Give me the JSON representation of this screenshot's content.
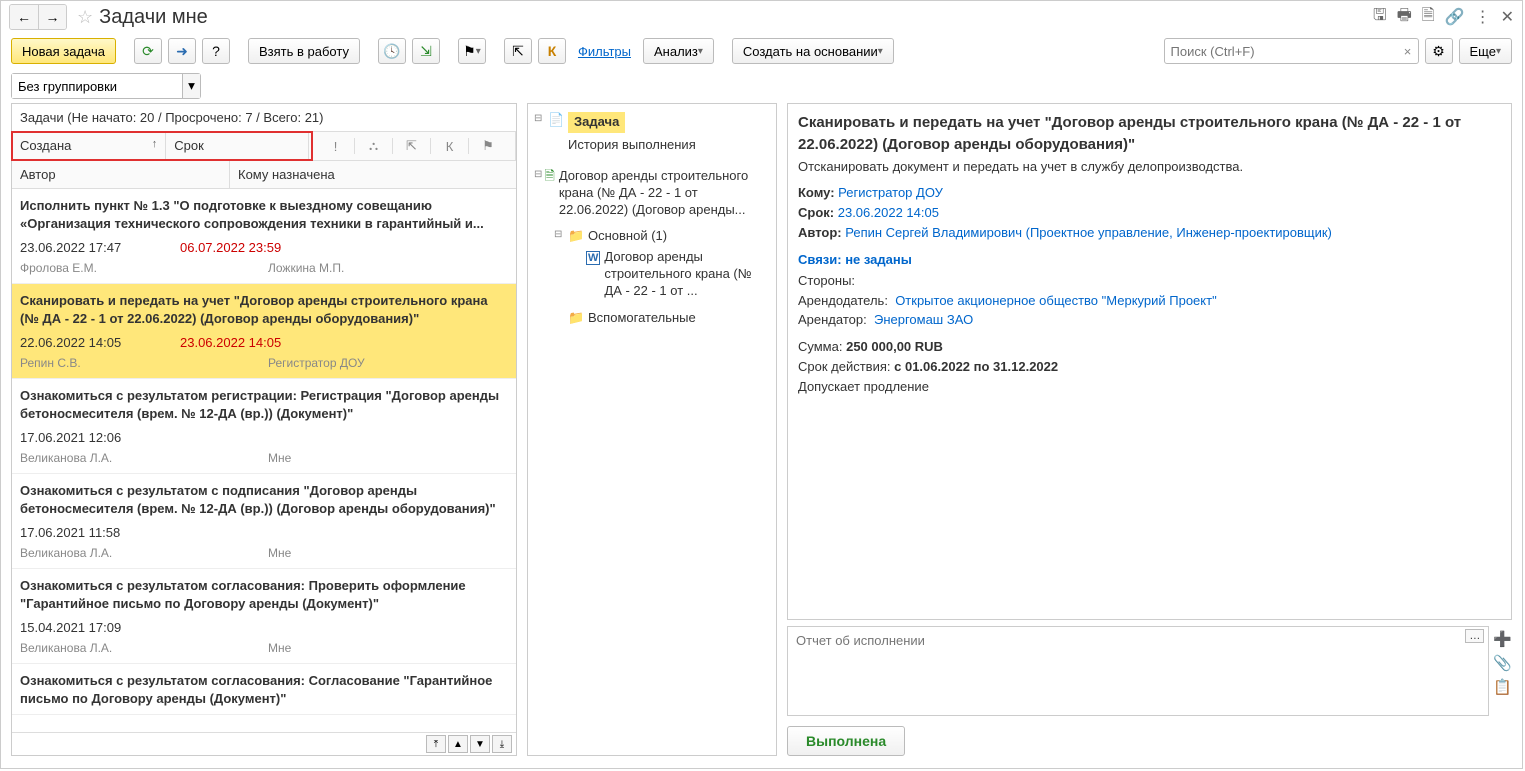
{
  "header": {
    "title": "Задачи мне"
  },
  "toolbar": {
    "new_task": "Новая задача",
    "take_to_work": "Взять в работу",
    "filters": "Фильтры",
    "analysis": "Анализ",
    "create_based_on": "Создать на основании",
    "search_placeholder": "Поиск (Ctrl+F)",
    "more": "Еще"
  },
  "grouping": {
    "value": "Без группировки"
  },
  "status_line": "Задачи (Не начато: 20 / Просрочено: 7 / Всего: 21)",
  "columns": {
    "created": "Создана",
    "due": "Срок",
    "author": "Автор",
    "assigned": "Кому назначена",
    "k_label": "К"
  },
  "tasks": [
    {
      "title": "Исполнить пункт № 1.3 \"О подготовке к выездному совещанию «Организация технического сопровождения техники в гарантийный и...",
      "created": "23.06.2022 17:47",
      "due": "06.07.2022 23:59",
      "overdue": true,
      "author": "Фролова Е.М.",
      "assigned": "Ложкина М.П."
    },
    {
      "title": "Сканировать и передать на учет \"Договор аренды строительного крана (№ ДА - 22 - 1 от 22.06.2022) (Договор аренды оборудования)\"",
      "created": "22.06.2022 14:05",
      "due": "23.06.2022 14:05",
      "overdue": true,
      "author": "Репин С.В.",
      "assigned": "Регистратор ДОУ",
      "selected": true
    },
    {
      "title": "Ознакомиться с результатом регистрации: Регистрация \"Договор аренды бетоносмесителя (врем. № 12-ДА (вр.)) (Документ)\"",
      "created": "17.06.2021 12:06",
      "due": "",
      "author": "Великанова Л.А.",
      "assigned": "Мне"
    },
    {
      "title": "Ознакомиться с результатом с подписания \"Договор аренды бетоносмесителя (врем. № 12-ДА (вр.)) (Договор аренды оборудования)\"",
      "created": "17.06.2021 11:58",
      "due": "",
      "author": "Великанова Л.А.",
      "assigned": "Мне"
    },
    {
      "title": "Ознакомиться с результатом согласования: Проверить оформление \"Гарантийное письмо по Договору аренды (Документ)\"",
      "created": "15.04.2021 17:09",
      "due": "",
      "author": "Великанова Л.А.",
      "assigned": "Мне"
    },
    {
      "title": "Ознакомиться с результатом согласования: Согласование \"Гарантийное письмо по Договору аренды (Документ)\"",
      "created": "",
      "due": "",
      "author": "",
      "assigned": ""
    }
  ],
  "tree": {
    "tab_task": "Задача",
    "history": "История выполнения",
    "doc_main": "Договор аренды строительного крана (№ ДА - 22 - 1 от 22.06.2022) (Договор аренды...",
    "folder_main": "Основной (1)",
    "doc_file": "Договор аренды строительного крана (№ ДА - 22 - 1 от ...",
    "folder_aux": "Вспомогательные"
  },
  "detail": {
    "title": "Сканировать и передать на учет \"Договор аренды строительного крана (№ ДА - 22 - 1 от 22.06.2022) (Договор аренды оборудования)\"",
    "subtitle": "Отсканировать документ и передать на учет в службу делопроизводства.",
    "to_label": "Кому:",
    "to_value": "Регистратор ДОУ",
    "due_label": "Срок:",
    "due_value": "23.06.2022 14:05",
    "author_label": "Автор:",
    "author_value": "Репин Сергей Владимирович (Проектное управление, Инженер-проектировщик)",
    "relations": "Связи: не заданы",
    "parties_label": "Стороны:",
    "lessor_label": "Арендодатель:",
    "lessor_value": "Открытое акционерное общество \"Меркурий Проект\"",
    "lessee_label": "Арендатор:",
    "lessee_value": "Энергомаш ЗАО",
    "sum_label": "Сумма:",
    "sum_value": "250 000,00 RUB",
    "period_label": "Срок действия:",
    "period_value": "с 01.06.2022 по 31.12.2022",
    "prolong": "Допускает продление"
  },
  "report": {
    "placeholder": "Отчет об исполнении"
  },
  "actions": {
    "done": "Выполнена"
  },
  "icons": {
    "plus_color": "#2aa82a"
  }
}
